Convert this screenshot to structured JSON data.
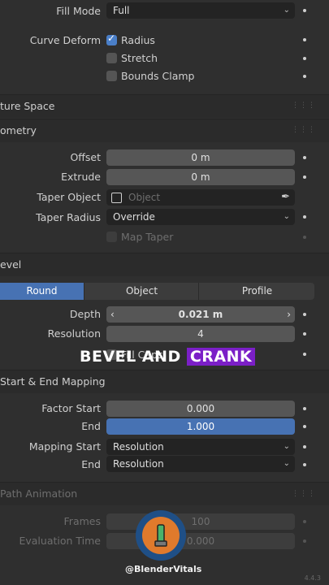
{
  "fill_mode": {
    "label": "Fill Mode",
    "value": "Full"
  },
  "curve_deform": {
    "label": "Curve Deform",
    "options": [
      {
        "label": "Radius",
        "checked": true
      },
      {
        "label": "Stretch",
        "checked": false
      },
      {
        "label": "Bounds Clamp",
        "checked": false
      }
    ]
  },
  "sections": {
    "texture_space": "ture Space",
    "geometry": "ometry",
    "bevel": "evel",
    "start_end": "Start & End Mapping",
    "path_animation": "Path Animation"
  },
  "geometry": {
    "offset": {
      "label": "Offset",
      "value": "0 m"
    },
    "extrude": {
      "label": "Extrude",
      "value": "0 m"
    },
    "taper_object": {
      "label": "Taper Object",
      "placeholder": "Object"
    },
    "taper_radius": {
      "label": "Taper Radius",
      "value": "Override"
    },
    "map_taper": {
      "label": "Map Taper"
    }
  },
  "bevel": {
    "tabs": [
      "Round",
      "Object",
      "Profile"
    ],
    "active_tab": "Round",
    "depth": {
      "label": "Depth",
      "value": "0.021 m"
    },
    "resolution": {
      "label": "Resolution",
      "value": "4"
    },
    "fill_caps": "Fill Caps"
  },
  "mapping": {
    "factor_start": {
      "label": "Factor Start",
      "value": "0.000"
    },
    "end": {
      "label": "End",
      "value": "1.000"
    },
    "mapping_start": {
      "label": "Mapping Start",
      "value": "Resolution"
    },
    "mapping_end": {
      "label": "End",
      "value": "Resolution"
    }
  },
  "path_animation": {
    "frames": {
      "label": "Frames",
      "value": "100"
    },
    "evaluation_time": {
      "label": "Evaluation Time",
      "value": "0.000"
    }
  },
  "caption": {
    "part1": "BEVEL AND ",
    "part2": "CRANK"
  },
  "watermark": {
    "handle": "@BlenderVitals"
  },
  "version": "4.4.3",
  "colors": {
    "accent": "#4772b3",
    "highlight": "#7b1fc7"
  }
}
